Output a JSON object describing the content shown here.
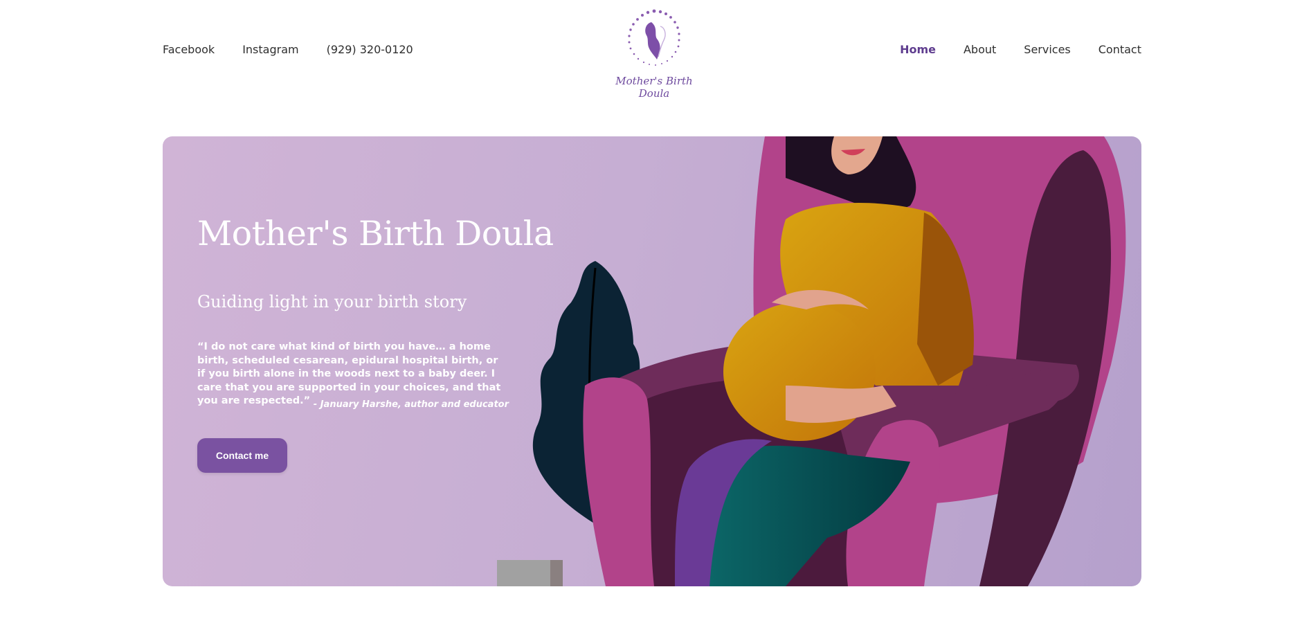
{
  "nav_left": {
    "facebook": "Facebook",
    "instagram": "Instagram",
    "phone": "(929) 320-0120"
  },
  "logo": {
    "text": "Mother's Birth Doula"
  },
  "nav_right": {
    "home": "Home",
    "about": "About",
    "services": "Services",
    "contact": "Contact"
  },
  "hero": {
    "title": "Mother's Birth Doula",
    "subtitle": "Guiding light in your birth story",
    "quote": "“I do not care what kind of birth you have… a home birth, scheduled cesarean, epidural hospital birth, or if you birth alone in the woods next to a baby deer. I care that you are supported in your choices, and that you are respected.”",
    "quote_author": "- January Harshe, author and educator",
    "cta_label": "Contact me"
  },
  "colors": {
    "accent": "#7a52a1",
    "active_nav": "#5f3d8f",
    "hero_bg": "#c6aed3"
  }
}
